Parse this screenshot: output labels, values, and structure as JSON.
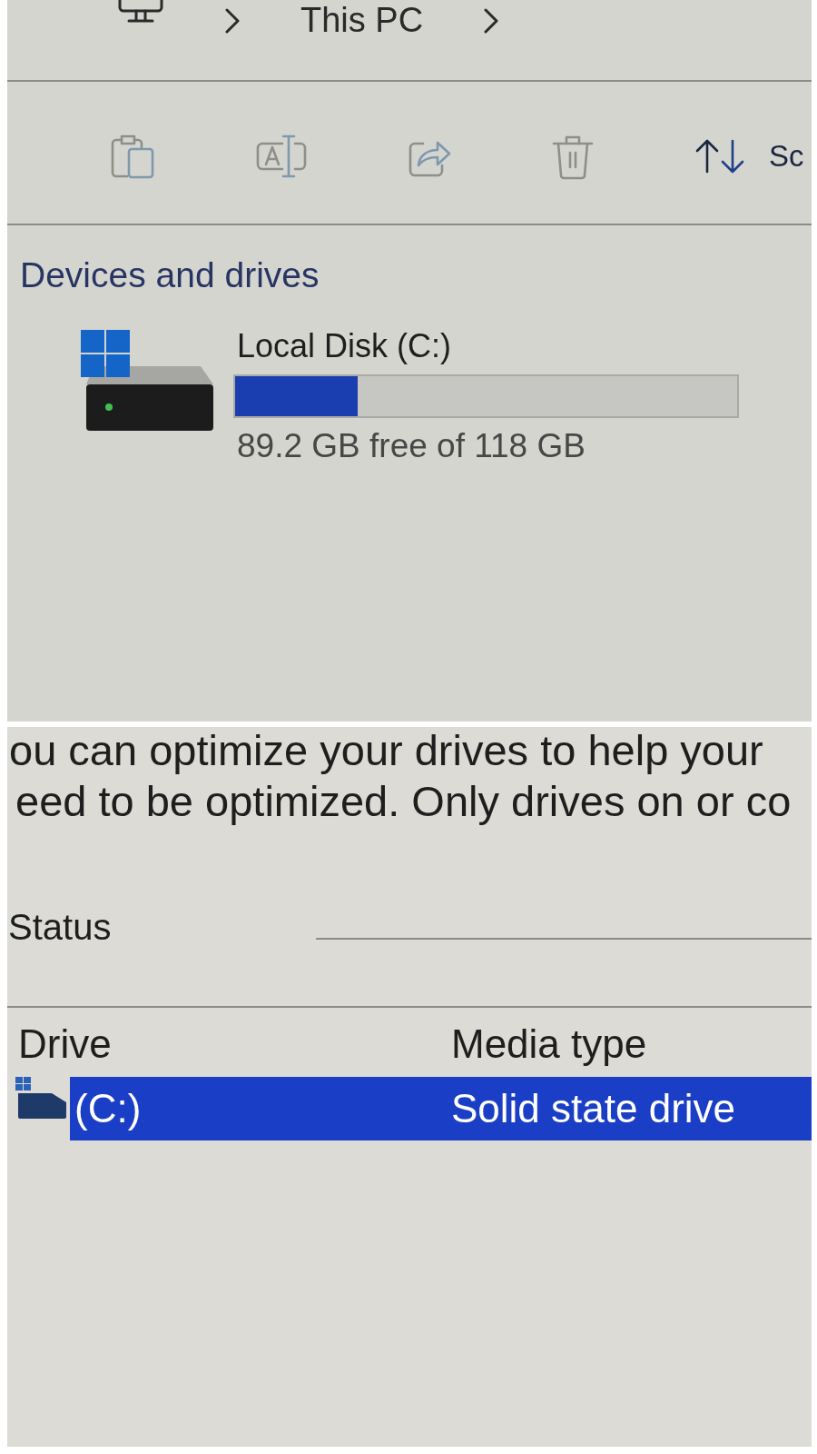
{
  "breadcrumb": {
    "items": [
      {
        "label": "This PC"
      }
    ]
  },
  "toolbar": {
    "buttons": [
      {
        "disabled": true
      },
      {
        "disabled": true
      },
      {
        "disabled": true
      },
      {
        "disabled": true
      },
      {
        "label": "Sc",
        "disabled": false
      }
    ]
  },
  "devices_section": {
    "heading": "Devices and drives",
    "drives": [
      {
        "name": "Local Disk (C:)",
        "level": 0.244,
        "space": "89.2 GB free of 118 GB"
      }
    ]
  },
  "optimize_panel": {
    "description_lines": [
      "ou can optimize your drives to help your",
      "eed to be optimized. Only drives on or co"
    ],
    "status_label": "Status",
    "table": {
      "columns": [
        "Drive",
        "Media type"
      ],
      "rows": [
        {
          "cells": [
            "(C:)",
            "Solid state drive"
          ],
          "selected": true
        }
      ]
    }
  }
}
